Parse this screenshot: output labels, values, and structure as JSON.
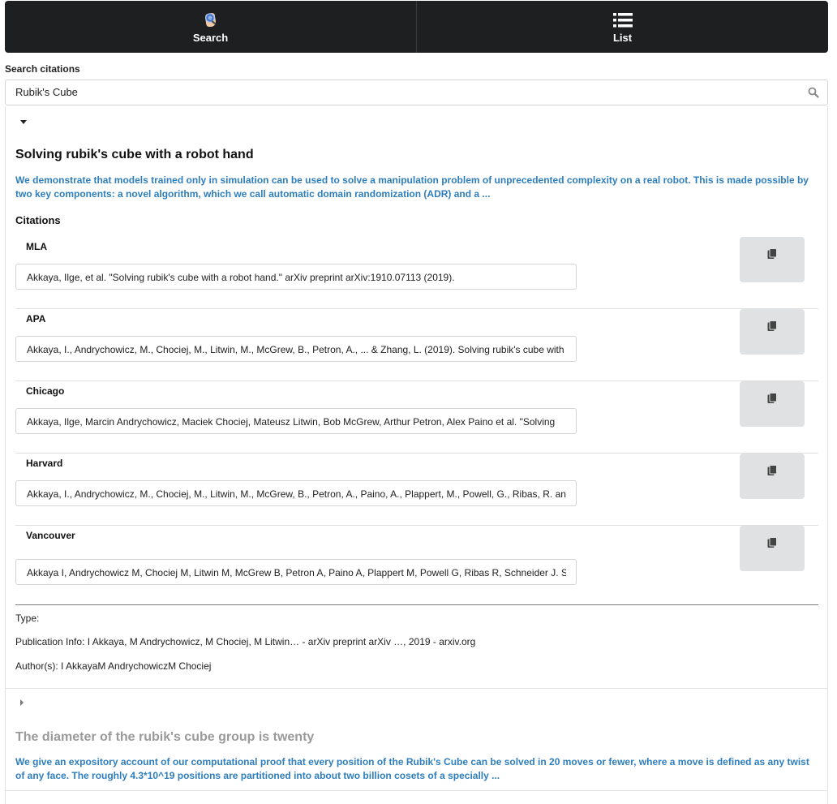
{
  "nav": {
    "tabs": [
      {
        "label": "Search",
        "icon": "search-hand-icon"
      },
      {
        "label": "List",
        "icon": "list-icon"
      }
    ]
  },
  "search": {
    "label": "Search citations",
    "value": "Rubik's Cube",
    "icon": "search-icon"
  },
  "results": [
    {
      "expanded": true,
      "title": "Solving rubik's cube with a robot hand",
      "snippet": "We demonstrate that models trained only in simulation can be used to solve a manipulation problem of unprecedented complexity on a real robot. This is made possible by two key components: a novel algorithm, which we call automatic domain randomization (ADR) and a ...",
      "citations_heading": "Citations",
      "citations": [
        {
          "style": "MLA",
          "text": "Akkaya, Ilge, et al. \"Solving rubik's cube with a robot hand.\" arXiv preprint arXiv:1910.07113 (2019)."
        },
        {
          "style": "APA",
          "text": "Akkaya, I., Andrychowicz, M., Chociej, M., Litwin, M., McGrew, B., Petron, A., ... & Zhang, L. (2019). Solving rubik's cube with"
        },
        {
          "style": "Chicago",
          "text": "Akkaya, Ilge, Marcin Andrychowicz, Maciek Chociej, Mateusz Litwin, Bob McGrew, Arthur Petron, Alex Paino et al. \"Solving"
        },
        {
          "style": "Harvard",
          "text": "Akkaya, I., Andrychowicz, M., Chociej, M., Litwin, M., McGrew, B., Petron, A., Paino, A., Plappert, M., Powell, G., Ribas, R. and"
        },
        {
          "style": "Vancouver",
          "text": "Akkaya I, Andrychowicz M, Chociej M, Litwin M, McGrew B, Petron A, Paino A, Plappert M, Powell G, Ribas R, Schneider J. S"
        }
      ],
      "type_line": "Type:",
      "publication_info": "Publication Info: I Akkaya, M Andrychowicz, M Chociej, M Litwin… - arXiv preprint arXiv …, 2019 - arxiv.org",
      "authors": "Author(s): I AkkayaM AndrychowiczM Chociej"
    },
    {
      "expanded": false,
      "title": "The diameter of the rubik's cube group is twenty",
      "snippet": "We give an expository account of our computational proof that every position of the Rubik's Cube can be solved in 20 moves or fewer, where a move is defined as any twist of any face. The roughly 4.3*10^19 positions are partitioned into about two billion cosets of a specially ..."
    }
  ],
  "colors": {
    "nav_bg": "#1d1f20",
    "snippet": "#2e7ebd",
    "copy_button": "#e0e1e2",
    "collapsed_title": "#9a9a9a"
  }
}
